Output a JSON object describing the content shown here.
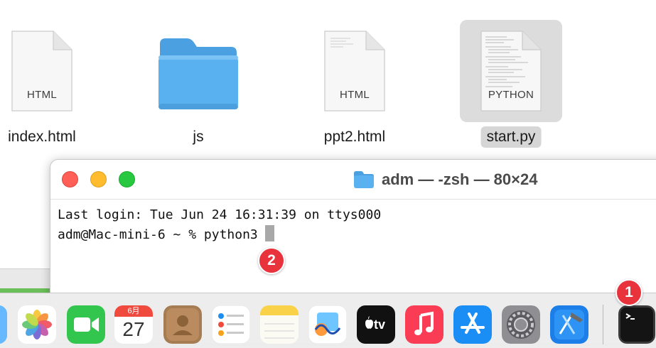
{
  "finder": {
    "items": [
      {
        "name": "index.html",
        "kind": "HTML"
      },
      {
        "name": "js",
        "kind": "folder"
      },
      {
        "name": "ppt2.html",
        "kind": "HTML"
      },
      {
        "name": "start.py",
        "kind": "PYTHON",
        "selected": true
      }
    ]
  },
  "terminal": {
    "title": "adm — -zsh — 80×24",
    "lines": [
      "Last login: Tue Jun 24 16:31:39 on ttys000",
      "adm@Mac-mini-6 ~ % python3"
    ]
  },
  "dock": {
    "apps": [
      "Finder",
      "Photos",
      "FaceTime",
      "Calendar",
      "Contacts",
      "Reminders",
      "Notes",
      "Freeform",
      "Apple TV",
      "Music",
      "App Store",
      "System Settings",
      "Xcode",
      "Terminal"
    ],
    "calendar": {
      "month": "6月",
      "day": "27"
    },
    "tv_label": "tv"
  },
  "annotations": {
    "badge_1": "1",
    "badge_2": "2"
  },
  "colors": {
    "folder_blue": "#5ab1f0",
    "badge_red": "#e8323c"
  }
}
